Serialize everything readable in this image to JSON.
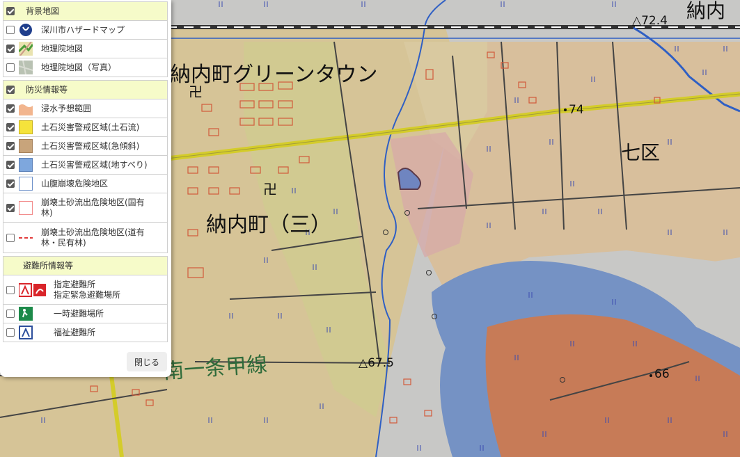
{
  "map": {
    "place_labels": {
      "greentown": "納内町グリーンタウン",
      "nouchi3": "納内町（三）",
      "nanaku": "七区",
      "nouchi_corner": "納内",
      "road": "南一条甲線"
    },
    "elevations": {
      "e72": "△72.4",
      "e74": "74",
      "e675": "△67.5",
      "e66": "66"
    },
    "temple_symbol": "卍",
    "symbols": {
      "paddy": "II",
      "orchard": "Q"
    }
  },
  "layer_panel": {
    "sections": [
      {
        "label": "背景地図",
        "checked": true,
        "items": [
          {
            "label": "深川市ハザードマップ",
            "checked": false,
            "icon": "city-logo-icon"
          },
          {
            "label": "地理院地図",
            "checked": true,
            "icon": "gsi-standard-map-icon"
          },
          {
            "label": "地理院地図（写真）",
            "checked": false,
            "icon": "gsi-photo-map-icon"
          }
        ]
      },
      {
        "label": "防災情報等",
        "checked": true,
        "items": [
          {
            "label": "浸水予想範囲",
            "checked": true,
            "icon": "flood-area-icon",
            "color": "#f2b58e"
          },
          {
            "label": "土石災害警戒区域(土石流)",
            "checked": true,
            "icon": "debris-flow-swatch",
            "color": "#f5e33b"
          },
          {
            "label": "土石災害警戒区域(急傾斜)",
            "checked": true,
            "icon": "steep-slope-swatch",
            "color": "#c8a47b"
          },
          {
            "label": "土石災害警戒区域(地すべり)",
            "checked": true,
            "icon": "landslide-swatch",
            "color": "#7ea7dd"
          },
          {
            "label": "山腹崩壊危険地区",
            "checked": true,
            "icon": "hillside-collapse-swatch",
            "color": "#6c8fc9"
          },
          {
            "label": "崩壊土砂流出危険地区(国有林)",
            "checked": true,
            "icon": "national-forest-sediment-swatch",
            "color": "#f28a8a"
          },
          {
            "label": "崩壊土砂流出危険地区(道有林・民有林)",
            "checked": false,
            "icon": "private-forest-sediment-dash-icon",
            "color": "#e23b3b"
          }
        ]
      },
      {
        "label": "避難所情報等",
        "items": [
          {
            "label": "指定避難所",
            "label2": "指定緊急避難場所",
            "checked": false,
            "icon": "designated-shelter-icons",
            "color": "#d9252a"
          },
          {
            "label": "一時避難場所",
            "checked": false,
            "icon": "temporary-evacuation-icon",
            "color": "#1d8a4a"
          },
          {
            "label": "福祉避難所",
            "checked": false,
            "icon": "welfare-shelter-icon",
            "color": "#2d4f9c"
          }
        ]
      }
    ],
    "close_label": "閉じる"
  }
}
